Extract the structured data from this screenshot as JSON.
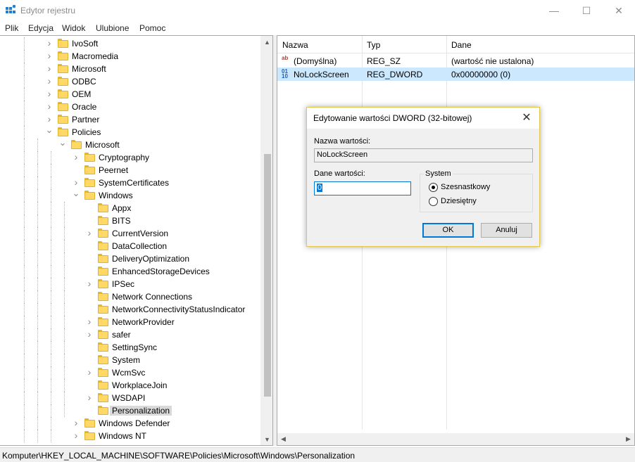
{
  "window": {
    "title": "Edytor rejestru",
    "controls": {
      "minimize": "—",
      "maximize": "☐",
      "close": "✕"
    }
  },
  "menu": [
    "Plik",
    "Edycja",
    "Widok",
    "Ulubione",
    "Pomoc"
  ],
  "tree": [
    {
      "label": "IvoSoft",
      "expander": "›"
    },
    {
      "label": "Macromedia",
      "expander": "›"
    },
    {
      "label": "Microsoft",
      "expander": "›"
    },
    {
      "label": "ODBC",
      "expander": "›"
    },
    {
      "label": "OEM",
      "expander": "›"
    },
    {
      "label": "Oracle",
      "expander": "›"
    },
    {
      "label": "Partner",
      "expander": "›"
    },
    {
      "label": "Policies",
      "expander": "⌄"
    },
    {
      "label": "Microsoft",
      "expander": "⌄"
    },
    {
      "label": "Cryptography",
      "expander": "›"
    },
    {
      "label": "Peernet",
      "expander": ""
    },
    {
      "label": "SystemCertificates",
      "expander": "›"
    },
    {
      "label": "Windows",
      "expander": "⌄"
    },
    {
      "label": "Appx",
      "expander": ""
    },
    {
      "label": "BITS",
      "expander": ""
    },
    {
      "label": "CurrentVersion",
      "expander": "›"
    },
    {
      "label": "DataCollection",
      "expander": ""
    },
    {
      "label": "DeliveryOptimization",
      "expander": ""
    },
    {
      "label": "EnhancedStorageDevices",
      "expander": ""
    },
    {
      "label": "IPSec",
      "expander": "›"
    },
    {
      "label": "Network Connections",
      "expander": ""
    },
    {
      "label": "NetworkConnectivityStatusIndicator",
      "expander": ""
    },
    {
      "label": "NetworkProvider",
      "expander": "›"
    },
    {
      "label": "safer",
      "expander": "›"
    },
    {
      "label": "SettingSync",
      "expander": ""
    },
    {
      "label": "System",
      "expander": ""
    },
    {
      "label": "WcmSvc",
      "expander": "›"
    },
    {
      "label": "WorkplaceJoin",
      "expander": ""
    },
    {
      "label": "WSDAPI",
      "expander": "›"
    },
    {
      "label": "Personalization",
      "expander": "",
      "selected": true
    },
    {
      "label": "Windows Defender",
      "expander": "›"
    },
    {
      "label": "Windows NT",
      "expander": "›"
    }
  ],
  "list": {
    "columns": {
      "name": "Nazwa",
      "type": "Typ",
      "data": "Dane"
    },
    "rows": [
      {
        "icon": "string-value-icon",
        "name": "(Domyślna)",
        "type": "REG_SZ",
        "data": "(wartość nie ustalona)"
      },
      {
        "icon": "binary-value-icon",
        "name": "NoLockScreen",
        "type": "REG_DWORD",
        "data": "0x00000000 (0)",
        "selected": true
      }
    ]
  },
  "status": {
    "path": "Komputer\\HKEY_LOCAL_MACHINE\\SOFTWARE\\Policies\\Microsoft\\Windows\\Personalization"
  },
  "dialog": {
    "title": "Edytowanie wartości DWORD (32-bitowej)",
    "value_name_label": "Nazwa wartości:",
    "value_name": "NoLockScreen",
    "value_data_label": "Dane wartości:",
    "value_data": "0",
    "base_group_label": "System",
    "base_options": [
      {
        "label": "Szesnastkowy",
        "checked": true
      },
      {
        "label": "Dziesiętny",
        "checked": false
      }
    ],
    "ok_label": "OK",
    "cancel_label": "Anuluj"
  },
  "colors": {
    "selection": "#cce8ff",
    "tree_selection": "#d9d9d9",
    "accent": "#0078d7",
    "folder": "#ffd866",
    "dialog_border": "#e3c84a"
  }
}
